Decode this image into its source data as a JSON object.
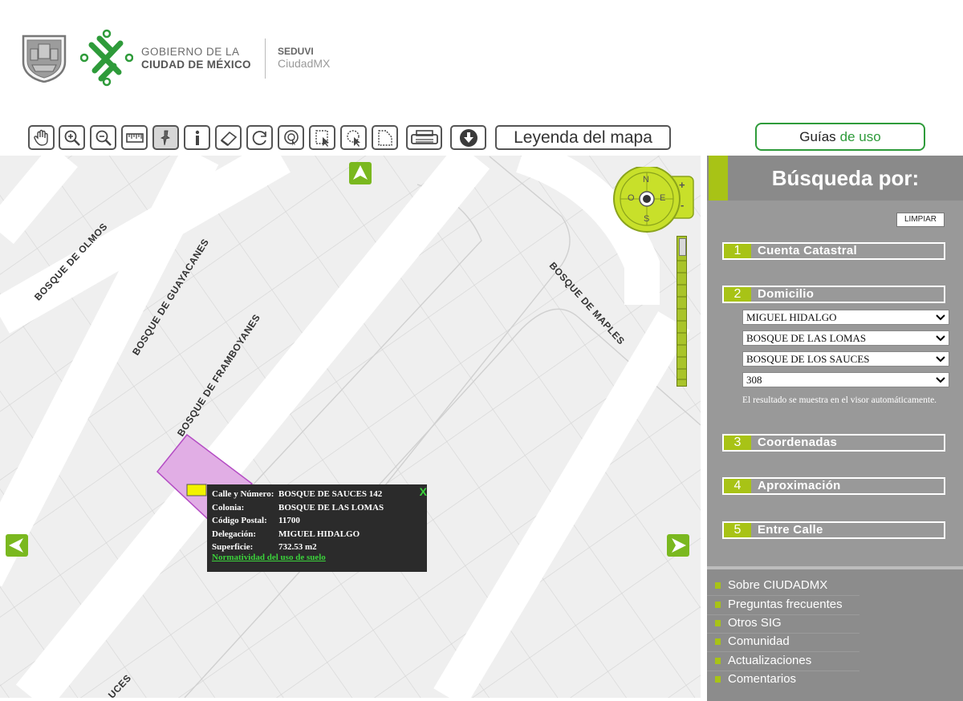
{
  "header": {
    "gov_line1": "GOBIERNO DE LA",
    "gov_line2": "CIUDAD DE MÉXICO",
    "agency": "SEDUVI",
    "agency_sub": "CiudadMX"
  },
  "toolbar": {
    "tools": [
      "hand-icon",
      "zoom-in-icon",
      "zoom-out-icon",
      "ruler-icon",
      "pin-icon",
      "info-icon",
      "eraser-icon",
      "refresh-icon",
      "locate-icon",
      "select-rect-icon",
      "select-lasso-icon",
      "select-polygon-icon",
      "print-icon",
      "download-icon"
    ],
    "legend_label": "Leyenda del mapa",
    "guides_label_a": "Guías",
    "guides_label_b": "de uso"
  },
  "map": {
    "streets": [
      "BOSQUE DE OLMOS",
      "BOSQUE DE GUAYACANES",
      "BOSQUE DE FRAMBOYANES",
      "BOSQUE DE MAPLES",
      "UCES"
    ],
    "compass": {
      "n": "N",
      "s": "S",
      "e": "E",
      "o": "O"
    },
    "popup": {
      "rows": [
        {
          "k": "Calle y Número:",
          "v": "BOSQUE DE SAUCES 142"
        },
        {
          "k": "Colonia:",
          "v": "BOSQUE DE LAS LOMAS"
        },
        {
          "k": "Código Postal:",
          "v": "11700"
        },
        {
          "k": "Delegación:",
          "v": "MIGUEL HIDALGO"
        },
        {
          "k": "Superficie:",
          "v": "732.53 m2"
        }
      ],
      "close": "X",
      "link": "Normatividad del uso de suelo"
    }
  },
  "panel": {
    "title": "Búsqueda por:",
    "clear": "LIMPIAR",
    "sections": [
      {
        "n": "1",
        "label": "Cuenta Catastral"
      },
      {
        "n": "2",
        "label": "Domicilio"
      },
      {
        "n": "3",
        "label": "Coordenadas"
      },
      {
        "n": "4",
        "label": "Aproximación"
      },
      {
        "n": "5",
        "label": "Entre Calle"
      }
    ],
    "selects": [
      "MIGUEL HIDALGO",
      "BOSQUE DE LAS LOMAS",
      "BOSQUE DE LOS SAUCES",
      "308"
    ],
    "note": "El resultado se muestra en el visor automáticamente.",
    "links": [
      "Sobre CIUDADMX",
      "Preguntas frecuentes",
      "Otros SIG",
      "Comunidad",
      "Actualizaciones",
      "Comentarios"
    ]
  },
  "colors": {
    "accent": "#a8c316",
    "brand_green": "#2e9b3a",
    "panel_gray": "#999999",
    "parcel": "#e1aee5"
  }
}
